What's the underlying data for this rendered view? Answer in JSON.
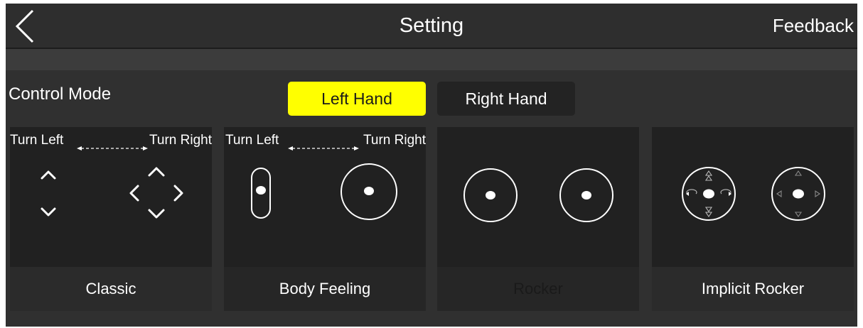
{
  "header": {
    "title": "Setting",
    "feedback_label": "Feedback",
    "back_icon": "chevron-left-icon"
  },
  "control_mode": {
    "label": "Control Mode",
    "hands": [
      {
        "label": "Left Hand",
        "selected": true
      },
      {
        "label": "Right Hand",
        "selected": false
      }
    ]
  },
  "modes": [
    {
      "label": "Classic",
      "selected": false,
      "turn_left": "Turn Left",
      "turn_right": "Turn Right"
    },
    {
      "label": "Body Feeling",
      "selected": false,
      "turn_left": "Turn Left",
      "turn_right": "Turn Right"
    },
    {
      "label": "Rocker",
      "selected": true
    },
    {
      "label": "Implicit Rocker",
      "selected": false
    }
  ],
  "colors": {
    "accent": "#ffff00",
    "background": "#303030",
    "card": "#212121"
  }
}
